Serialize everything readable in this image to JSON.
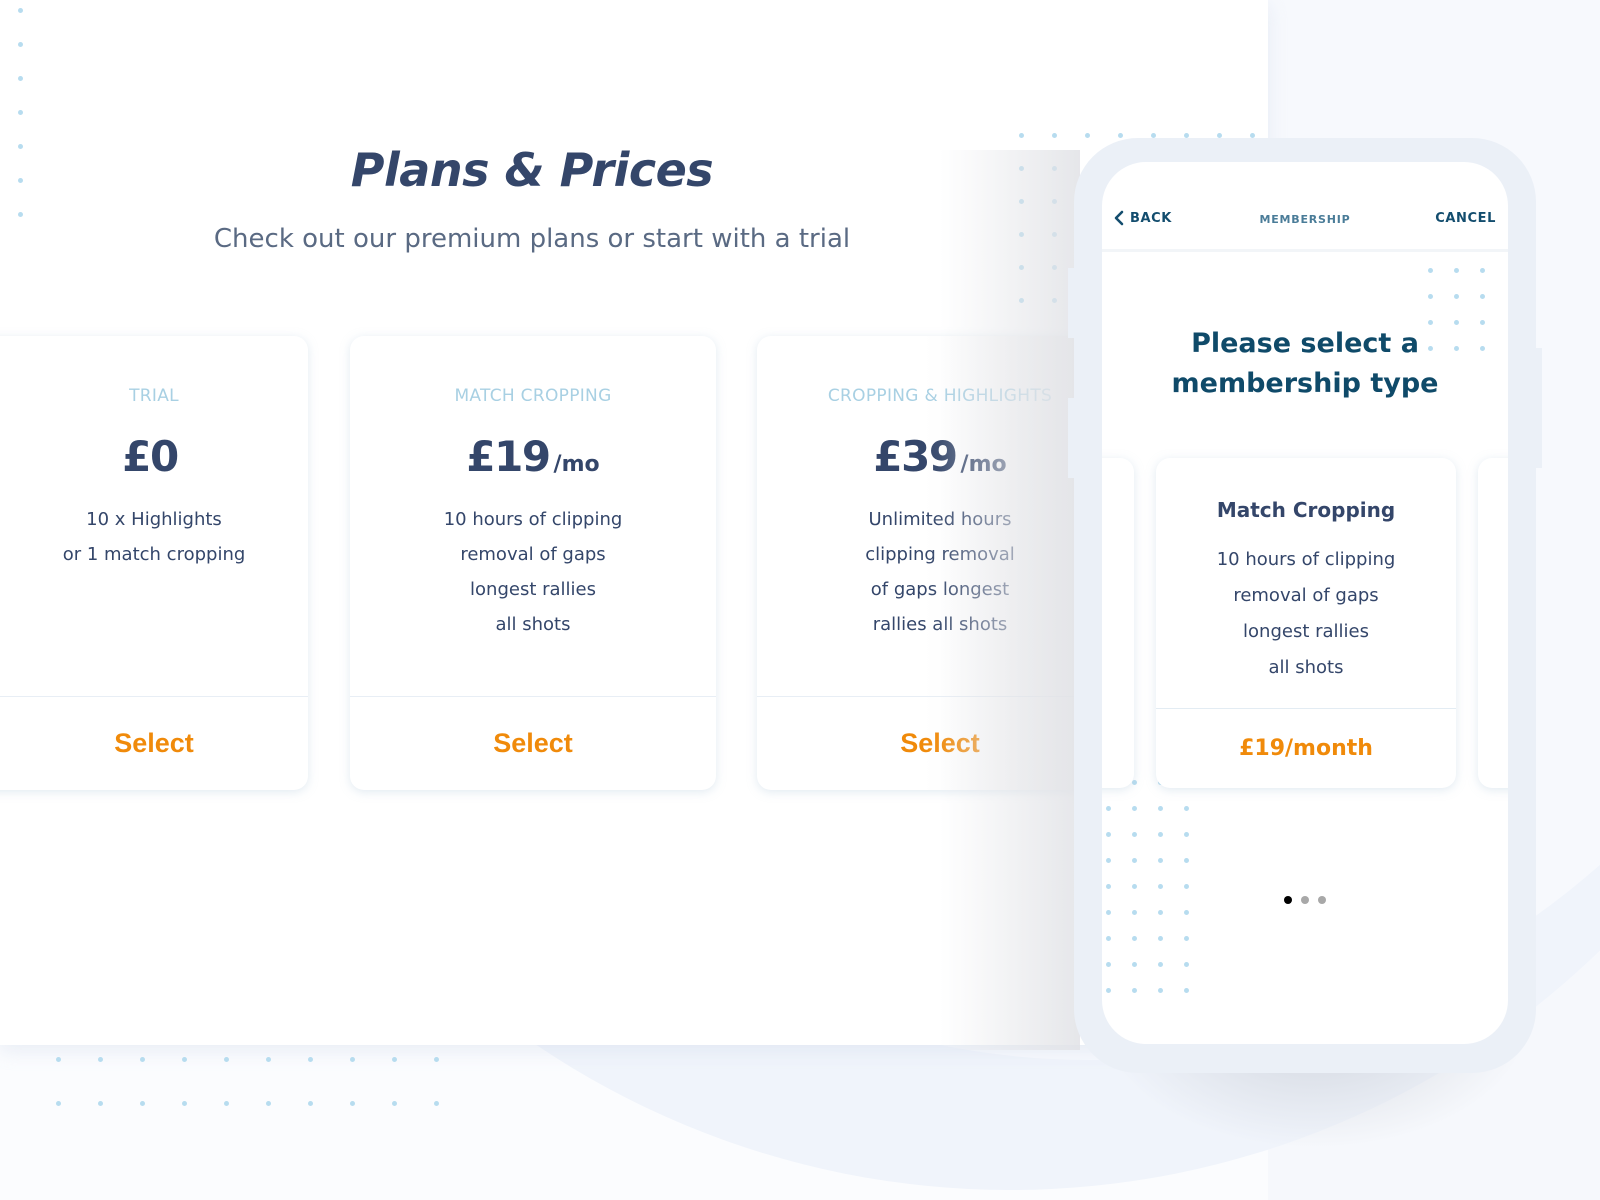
{
  "page": {
    "title": "Plans & Prices",
    "subtitle": "Check out our premium plans or start with a trial"
  },
  "plans": [
    {
      "name": "TRIAL",
      "amount": "£0",
      "unit": "",
      "features": [
        "10 x Highlights",
        "or 1 match cropping"
      ],
      "button_label": "Select"
    },
    {
      "name": "MATCH CROPPING",
      "amount": "£19",
      "unit": "/mo",
      "features": [
        "10 hours of clipping",
        "removal of gaps",
        "longest rallies",
        "all shots"
      ],
      "button_label": "Select"
    },
    {
      "name": "CROPPING & HIGHLIGHTS",
      "amount": "£39",
      "unit": "/mo",
      "features": [
        "Unlimited hours",
        "clipping removal",
        "of gaps longest",
        "rallies all shots"
      ],
      "button_label": "Select"
    }
  ],
  "phone": {
    "nav": {
      "back_label": "BACK",
      "title": "MEMBERSHIP",
      "cancel_label": "CANCEL"
    },
    "heading_line1": "Please select a",
    "heading_line2": "membership type",
    "membership_card": {
      "name": "Match Cropping",
      "features": [
        "10 hours of clipping",
        "removal of gaps",
        "longest rallies",
        "all shots"
      ],
      "price_label": "£19/month"
    },
    "pager": {
      "total": 3,
      "active_index": 0
    }
  },
  "colors": {
    "heading": "#34466a",
    "plan_label": "#a8d0e3",
    "accent_orange": "#f08a0a",
    "phone_nav": "#134d6e",
    "phone_frame": "#ebf0f7",
    "dot_pattern": "#b7dcef"
  }
}
